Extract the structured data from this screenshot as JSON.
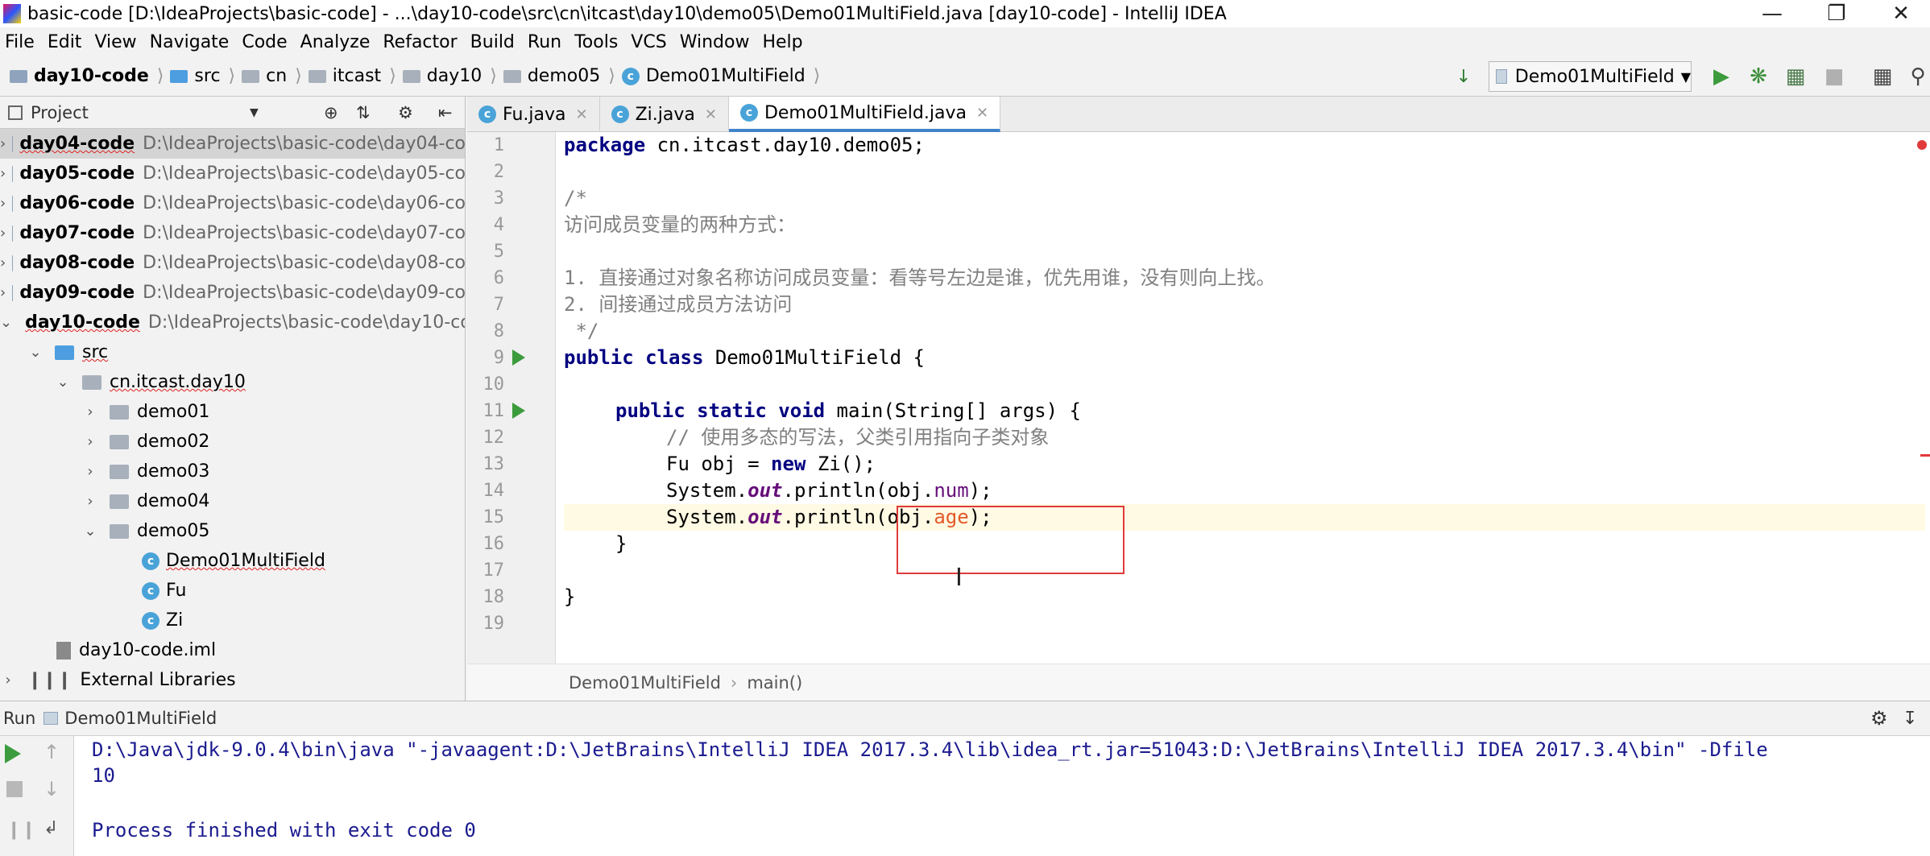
{
  "window": {
    "title": "basic-code [D:\\IdeaProjects\\basic-code] - ...\\day10-code\\src\\cn\\itcast\\day10\\demo05\\Demo01MultiField.java [day10-code] - IntelliJ IDEA"
  },
  "menu": [
    "File",
    "Edit",
    "View",
    "Navigate",
    "Code",
    "Analyze",
    "Refactor",
    "Build",
    "Run",
    "Tools",
    "VCS",
    "Window",
    "Help"
  ],
  "breadcrumbs": [
    "day10-code",
    "src",
    "cn",
    "itcast",
    "day10",
    "demo05",
    "Demo01MultiField"
  ],
  "run_config": "Demo01MultiField",
  "project_panel": {
    "title": "Project",
    "modules": [
      {
        "name": "day04-code",
        "path": "D:\\IdeaProjects\\basic-code\\day04-co"
      },
      {
        "name": "day05-code",
        "path": "D:\\IdeaProjects\\basic-code\\day05-co"
      },
      {
        "name": "day06-code",
        "path": "D:\\IdeaProjects\\basic-code\\day06-co"
      },
      {
        "name": "day07-code",
        "path": "D:\\IdeaProjects\\basic-code\\day07-co"
      },
      {
        "name": "day08-code",
        "path": "D:\\IdeaProjects\\basic-code\\day08-co"
      },
      {
        "name": "day09-code",
        "path": "D:\\IdeaProjects\\basic-code\\day09-co"
      },
      {
        "name": "day10-code",
        "path": "D:\\IdeaProjects\\basic-code\\day10-co"
      }
    ],
    "src": "src",
    "package": "cn.itcast.day10",
    "packages": [
      "demo01",
      "demo02",
      "demo03",
      "demo04",
      "demo05"
    ],
    "classes": [
      "Demo01MultiField",
      "Fu",
      "Zi"
    ],
    "iml": "day10-code.iml",
    "external": "External Libraries"
  },
  "tabs": [
    "Fu.java",
    "Zi.java",
    "Demo01MultiField.java"
  ],
  "line_numbers": [
    "1",
    "2",
    "3",
    "4",
    "5",
    "6",
    "7",
    "8",
    "9",
    "10",
    "11",
    "12",
    "13",
    "14",
    "15",
    "16",
    "17",
    "18",
    "19"
  ],
  "code": {
    "l1_kw": "package",
    "l1_rest": " cn.itcast.day10.demo05;",
    "l3": "/*",
    "l4": "访问成员变量的两种方式：",
    "l6": "1. 直接通过对象名称访问成员变量：看等号左边是谁，优先用谁，没有则向上找。",
    "l7": "2. 间接通过成员方法访问",
    "l8": " */",
    "l9_kw": "public class",
    "l9_rest": " Demo01MultiField {",
    "l11_kw": "public static void",
    "l11_rest": " main(String[] args) {",
    "l12": "// 使用多态的写法，父类引用指向子类对象",
    "l13_a": "Fu obj = ",
    "l13_kw": "new",
    "l13_b": " Zi();",
    "l14_a": "System.",
    "l14_out": "out",
    "l14_b": ".println(obj.",
    "l14_fld": "num",
    "l14_c": ");",
    "l15_a": "System.",
    "l15_out": "out",
    "l15_b": ".println(obj.",
    "l15_fld": "age",
    "l15_c": ");",
    "l16": "}",
    "l18": "}"
  },
  "editor_breadcrumb": [
    "Demo01MultiField",
    "main()"
  ],
  "run_panel": {
    "label": "Run",
    "config": "Demo01MultiField",
    "lines": [
      "D:\\Java\\jdk-9.0.4\\bin\\java \"-javaagent:D:\\JetBrains\\IntelliJ IDEA 2017.3.4\\lib\\idea_rt.jar=51043:D:\\JetBrains\\IntelliJ IDEA 2017.3.4\\bin\" -Dfile",
      "10",
      "",
      "Process finished with exit code 0"
    ]
  },
  "colors": {
    "keyword": "#000080",
    "comment": "#808080",
    "field": "#660e7a",
    "error": "#e35a2a",
    "console": "#1b1b8f"
  }
}
